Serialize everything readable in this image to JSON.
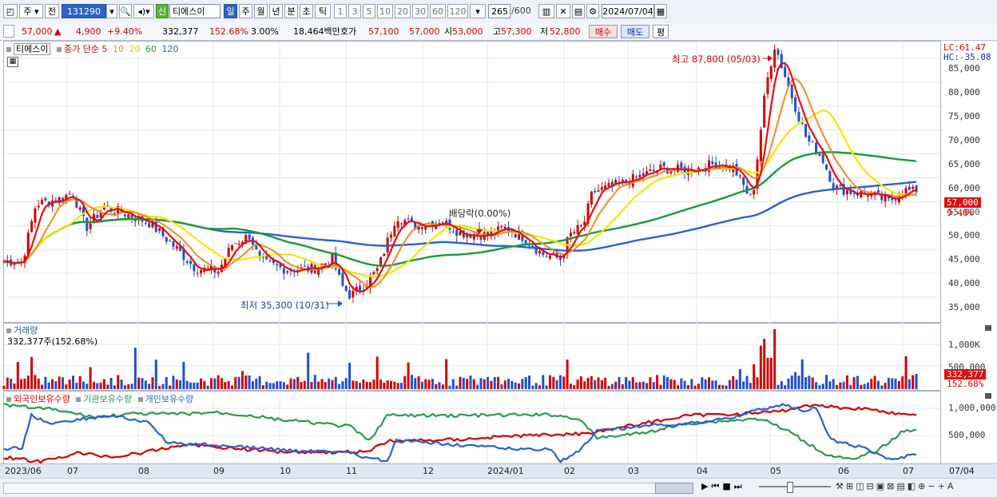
{
  "toolbar": {
    "period": "주",
    "prev": "전",
    "code": "131290",
    "sin": "신",
    "stock_name": "티에스이",
    "tabs": [
      "일",
      "주",
      "월",
      "년",
      "분",
      "초",
      "틱"
    ],
    "active_tab": "일",
    "intervals": [
      "1",
      "3",
      "5",
      "10",
      "20",
      "30",
      "60",
      "120"
    ],
    "count": "265",
    "count_total": "/600",
    "date": "2024/07/04"
  },
  "quote": {
    "price": "57,000",
    "change_arrow": "▲",
    "change": "4,900",
    "change_pct": "+9.40%",
    "volume": "332,377",
    "volume_ratio": "152.68%",
    "turnover_pct": "3.00%",
    "trade_value": "18,464백만",
    "ask_label": "호가",
    "ask1": "57,100",
    "ask2": "57,000",
    "open_label": "시",
    "open": "53,000",
    "high_label": "고",
    "high": "57,300",
    "low_label": "저",
    "low": "52,800",
    "buy": "매수",
    "sell": "매도",
    "flat": "평"
  },
  "price_pane": {
    "legend_name": "티에스이",
    "legend_ma": "종가 단순",
    "ma_periods": [
      "5",
      "10",
      "20",
      "60",
      "120"
    ],
    "lc": "LC:61.47",
    "hc": "HC:-35.08",
    "high_note": "최고 87,800 (05/03)",
    "low_note": "최저 35,300 (10/31)",
    "div_note": "배당락(0.00%)",
    "price_tag": "57,000",
    "pct_tag": "9.40%",
    "y_ticks": [
      "85,000",
      "80,000",
      "75,000",
      "70,000",
      "65,000",
      "60,000",
      "55,000",
      "50,000",
      "45,000",
      "40,000",
      "35,000"
    ]
  },
  "volume_pane": {
    "title": "거래량",
    "value": "332,377주(152.68%)",
    "y_ticks": [
      "1,000K",
      "500,000"
    ],
    "tag_value": "332,377",
    "tag_pct": "152.68%"
  },
  "holdings_pane": {
    "legend": [
      "외국인보유수량",
      "기관보유수량",
      "개인보유수량"
    ],
    "y_ticks": [
      "1,000,000",
      "500,000"
    ]
  },
  "x_axis": [
    "2023/06",
    "07",
    "08",
    "09",
    "10",
    "11",
    "12",
    "2024/01",
    "02",
    "03",
    "04",
    "05",
    "06",
    "07",
    "07/04"
  ],
  "colors": {
    "ma5": "#e01010",
    "ma10": "#f08c1e",
    "ma20": "#f5e600",
    "ma60": "#1a9a3a",
    "ma120": "#2b5fd9",
    "up": "#d40000",
    "down": "#1f4fd0",
    "foreign": "#d40000",
    "institution": "#2a9a50",
    "individual": "#2b5fd9"
  },
  "chart_data": {
    "type": "candlestick",
    "x_range": [
      "2023/06",
      "2024/07/04"
    ],
    "ylim": [
      33000,
      88000
    ],
    "high": {
      "value": 87800,
      "date": "05/03"
    },
    "low": {
      "value": 35300,
      "date": "10/31"
    },
    "last": {
      "open": 53000,
      "high": 57300,
      "low": 52800,
      "close": 57000
    }
  }
}
